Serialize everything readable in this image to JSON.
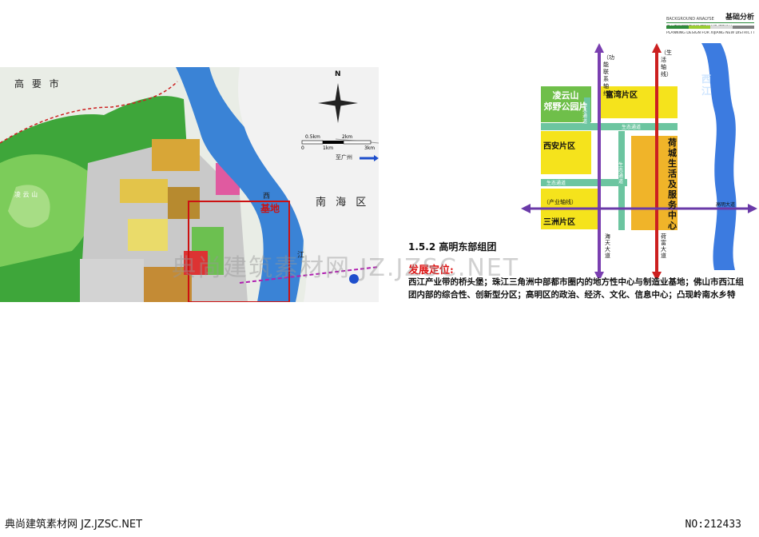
{
  "header": {
    "en_title": "BACKGROUND ANALYSE",
    "zh_title": "基础分析",
    "subtitle": "佛山市高明区西江新城区规划及城市设计",
    "subtitle_en": "PLANNING DESIGN FOR XIJIANG NEW DISTRICT IN GAOMING FOSHAN",
    "bar_colors": [
      "#2e8b3a",
      "#9acd32",
      "#d9d9d9",
      "#7f7f7f"
    ]
  },
  "map": {
    "labels": {
      "gaoyao": "高 要 市",
      "nanhai": "南 海 区",
      "lingyun": "凌 云 山",
      "xi": "西",
      "jiang": "江",
      "site": "基地",
      "to_guangzhou": "至广州"
    },
    "north": "N",
    "scale": [
      "0",
      "0.5km",
      "1km",
      "2km",
      "3km"
    ]
  },
  "diagram": {
    "lingyun": [
      "凌云山",
      "郊野公园片"
    ],
    "fuwan": "富湾片区",
    "xian": "西安片区",
    "sanzhou": "三洲片区",
    "industry_axis": "（产业轴线）",
    "heyun_city": "荷城生活及服务中心",
    "func_axis": "（功能联系轴线）",
    "life_axis": "（生活轴线）",
    "eco1": "生态通道",
    "eco2": "生态通道",
    "eco3": "生态通道",
    "eco4": "生态通道",
    "eco5": "生态通道",
    "haitian": "海天大道",
    "hefu": "荷富大道",
    "gaoming": "高明大道",
    "river": "西江",
    "colors": {
      "yellow": "#f5e31c",
      "orange": "#f0b429",
      "green": "#6fbf4a",
      "mint": "#6cc5a0",
      "purple": "#7a3fb0",
      "red": "#cc2020",
      "blue": "#3c7be0"
    }
  },
  "section": {
    "title": "1.5.2 高明东部组团",
    "positioning_label": "发展定位:",
    "body": "西江产业带的桥头堡；珠江三角洲中部都市圈内的地方性中心与制造业基地；佛山市西江组团内部的综合性、创新型分区；高明区的政治、经济、文化、信息中心；凸现岭南水乡特色、湖光山色、水网交错、适宜创业与人居的“西江水都”。"
  },
  "watermark": "典尚建筑素材网 JZ.JZSC.NET",
  "footer": {
    "left": "典尚建筑素材网 JZ.JZSC.NET",
    "right": "NO:212433"
  }
}
